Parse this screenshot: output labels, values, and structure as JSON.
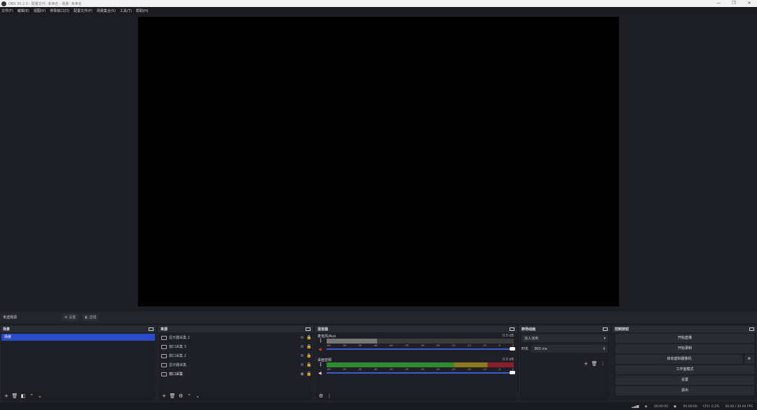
{
  "window": {
    "title": "OBS 30.2.0 - 配置文件: 未命名 - 场景: 未命名"
  },
  "menu": [
    "文件(F)",
    "编辑(E)",
    "视图(V)",
    "停靠窗口(D)",
    "配置文件(P)",
    "场景集合(S)",
    "工具(T)",
    "帮助(H)"
  ],
  "source_bar": {
    "no_selection": "未选择源",
    "properties": "设置",
    "filters": "滤镜"
  },
  "scenes": {
    "title": "场景",
    "items": [
      "场景"
    ]
  },
  "sources": {
    "title": "来源",
    "items": [
      {
        "label": "显示器采集 2",
        "visible": false
      },
      {
        "label": "窗口采集 3",
        "visible": false
      },
      {
        "label": "窗口采集 2",
        "visible": false
      },
      {
        "label": "显示器采集",
        "visible": false
      },
      {
        "label": "窗口采集",
        "visible": true
      }
    ]
  },
  "mixer": {
    "title": "混音器",
    "channels": [
      {
        "name": "麦克风/Aux",
        "db": "0.0 dB",
        "level": 0.27
      },
      {
        "name": "桌面音频",
        "db": "0.0 dB",
        "level": 1.0
      }
    ],
    "ticks": [
      "-60",
      "-55",
      "-50",
      "-45",
      "-40",
      "-35",
      "-30",
      "-25",
      "-20",
      "-15",
      "-10",
      "-5",
      "0"
    ]
  },
  "transitions": {
    "title": "转场动画",
    "selected": "淡入淡出",
    "duration_label": "时长",
    "duration": "300 ms"
  },
  "controls": {
    "title": "控制按钮",
    "buttons": [
      "开始直播",
      "开始录制",
      "启动虚拟摄像机",
      "工作室模式",
      "设置",
      "退出"
    ]
  },
  "status": {
    "stream_time": "00:00:00",
    "record_time": "00:00:00",
    "cpu": "CPU: 0.2%",
    "fps": "30.00 / 30.00 FPS"
  },
  "colors": {
    "accent": "#2a4bc8",
    "meter_green": "#2e8b2e",
    "meter_yellow": "#8b7a1e",
    "meter_red": "#8b1e2a"
  }
}
